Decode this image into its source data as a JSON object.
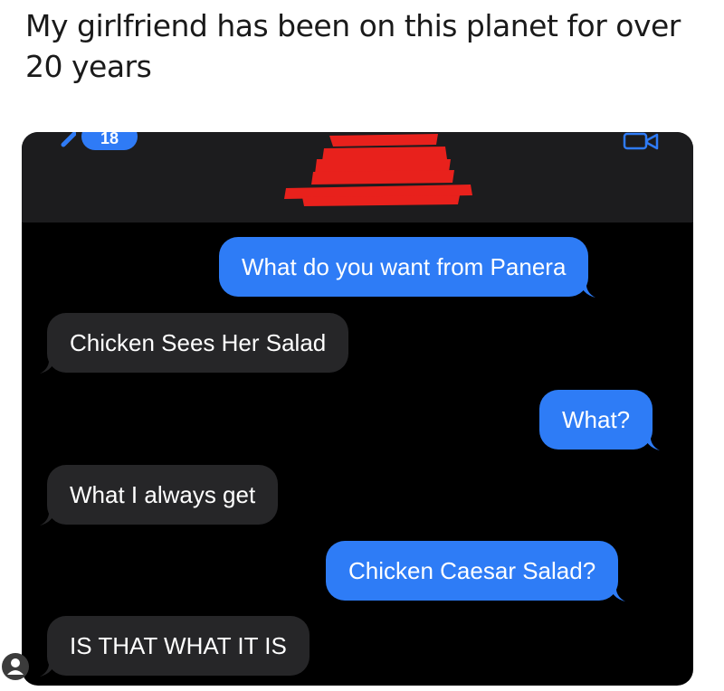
{
  "caption": "My girlfriend has been on this planet for over 20 years",
  "header": {
    "back_count": "18",
    "redaction_color": "#e8211c"
  },
  "colors": {
    "sent_bubble": "#2e7cf6",
    "received_bubble": "#262628",
    "background": "#000000"
  },
  "messages": [
    {
      "direction": "sent",
      "text": "What do you want from Panera"
    },
    {
      "direction": "received",
      "text": "Chicken Sees Her Salad"
    },
    {
      "direction": "sent",
      "text": "What?"
    },
    {
      "direction": "received",
      "text": "What I always get"
    },
    {
      "direction": "sent",
      "text": "Chicken Caesar Salad?"
    },
    {
      "direction": "received",
      "text": "IS THAT WHAT IT IS"
    }
  ]
}
